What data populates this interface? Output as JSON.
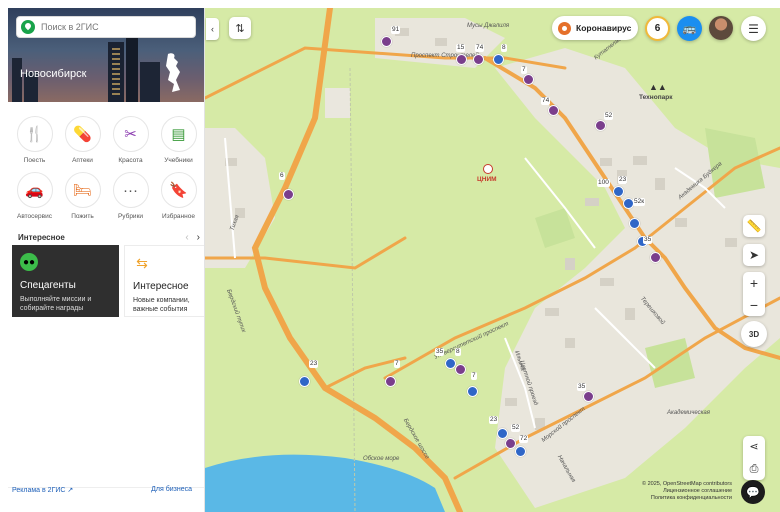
{
  "search": {
    "placeholder": "Поиск в 2ГИС"
  },
  "city": "Новосибирск",
  "categories": [
    {
      "label": "Поесть",
      "icon": "fork-knife-icon"
    },
    {
      "label": "Аптеки",
      "icon": "pill-icon"
    },
    {
      "label": "Красота",
      "icon": "scissors-icon"
    },
    {
      "label": "Учебники",
      "icon": "book-icon"
    },
    {
      "label": "Автосервис",
      "icon": "car-service-icon"
    },
    {
      "label": "Пожить",
      "icon": "bed-icon"
    },
    {
      "label": "Рубрики",
      "icon": "dots-icon"
    },
    {
      "label": "Избранное",
      "icon": "bookmark-icon"
    }
  ],
  "interesting": {
    "title": "Интересное"
  },
  "cards": [
    {
      "title": "Спецагенты",
      "subtitle": "Выполняйте миссии и собирайте награды"
    },
    {
      "title": "Интересное",
      "subtitle": "Новые компании, важные события"
    }
  ],
  "footer": {
    "ads": "Реклама в 2ГИС ↗",
    "business": "Для бизнеса"
  },
  "header": {
    "corona": "Коронавирус",
    "badge": "6"
  },
  "map": {
    "labels": {
      "musy": "Мусы Джалиля",
      "stroit": "Проспект Строителей",
      "kutat": "Кутателадзе",
      "technopark": "Технопарк",
      "tsnim": "ЦНИМ",
      "tikhaya": "Тихая",
      "berdsk": "Бердский тупик",
      "obskoe": "Обское море",
      "ilicha": "Ильича",
      "tsvetnoy": "Цветной проезд",
      "morskoy": "Морской проспект",
      "akademicheskaya": "Академическая",
      "nachalnaya": "Начальная",
      "tereshkovoy": "Терешковой",
      "bulvar": "Академика Будкера",
      "university": "Университетский проспект",
      "berdskoe": "Бердское шоссе"
    },
    "copyright": [
      "© 2025, OpenStreetMap contributors",
      "Лицензионное соглашение",
      "Политика конфиденциальности"
    ],
    "route_numbers": [
      "91",
      "15",
      "74",
      "8",
      "7",
      "74",
      "52",
      "100",
      "23",
      "52к",
      "35",
      "6",
      "23",
      "7",
      "35",
      "8",
      "7",
      "35",
      "23",
      "52",
      "72"
    ]
  },
  "controls": {
    "zoom_in": "+",
    "zoom_out": "−",
    "three_d": "3D"
  }
}
